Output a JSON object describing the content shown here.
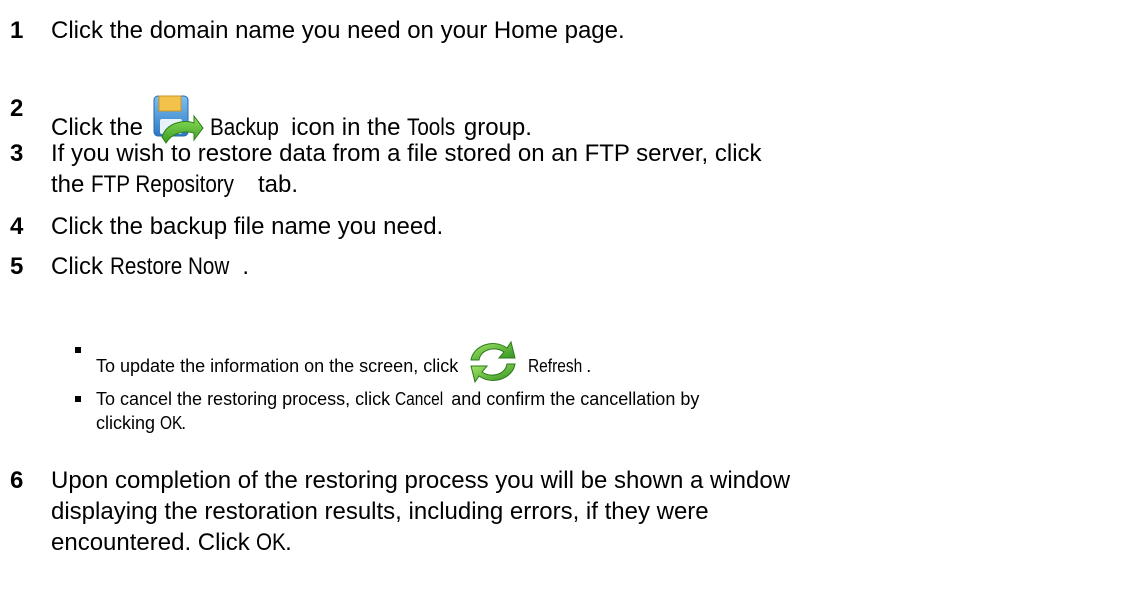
{
  "steps": [
    {
      "num": "1",
      "text": "Click the domain name you need on your Home page."
    },
    {
      "num": "2",
      "pre": "Click the",
      "icon": "backup-floppy-icon",
      "ui": "Backup",
      "mid": "icon in the",
      "ui2": "Tools",
      "post": "group."
    },
    {
      "num": "3",
      "pre": "If you wish to restore data from a file stored on an FTP server, click",
      "pre2": "the",
      "ui": "FTP Repository",
      "post": "tab."
    },
    {
      "num": "4",
      "text": "Click the backup file name you need."
    },
    {
      "num": "5",
      "pre": "Click",
      "ui": "Restore Now",
      "post": "."
    },
    {
      "num": "6",
      "line1": "Upon completion of the restoring process you will be shown a window",
      "line2": "displaying the restoration results, including errors, if they were",
      "line3": "encountered. Click",
      "ui": "OK",
      "post": "."
    }
  ],
  "subitems": [
    {
      "pre": "To update the information on the screen, click",
      "icon": "refresh-arrows-icon",
      "ui": "Refresh",
      "post": "."
    },
    {
      "pre": "To cancel the restoring process, click",
      "ui": "Cancel",
      "mid": "and confirm the cancellation by",
      "pre2": "clicking",
      "ui2": "OK",
      "post": "."
    }
  ],
  "colors": {
    "text": "#000000",
    "background": "#ffffff",
    "refresh_icon": "#3aa02a",
    "backup_icon_blue": "#3d8fd8",
    "backup_icon_green": "#4cb030"
  }
}
